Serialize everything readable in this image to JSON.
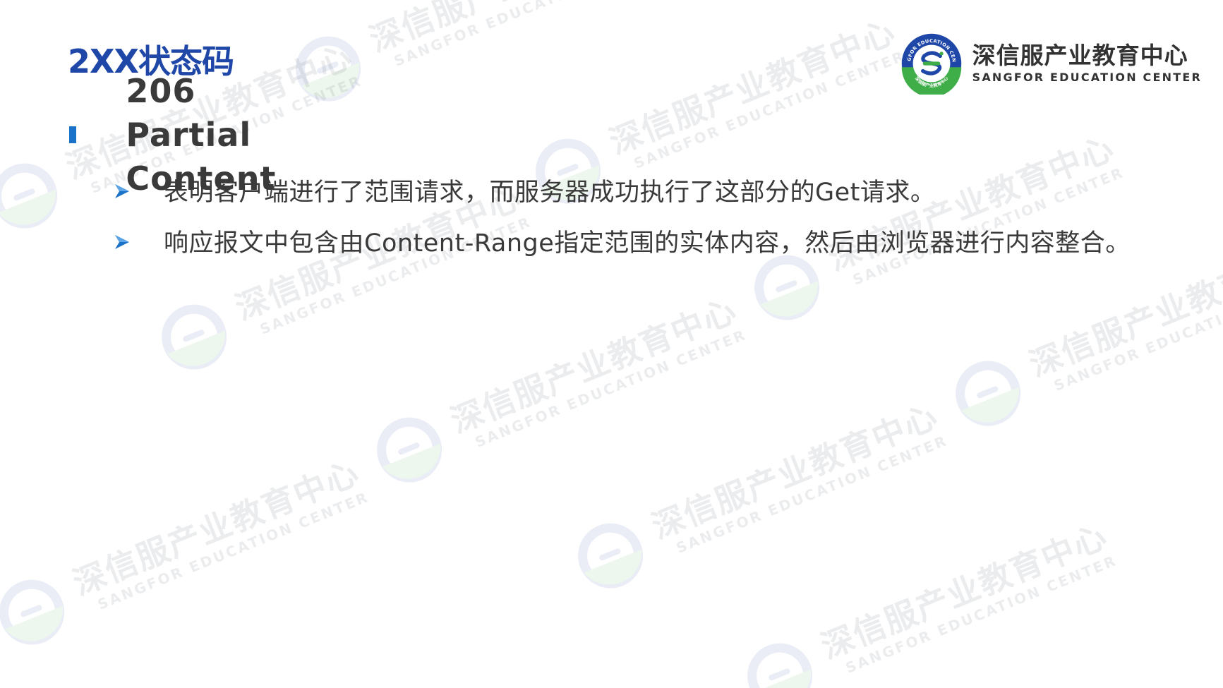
{
  "slide": {
    "title": "2XX状态码",
    "heading": "206 Partial Content",
    "bullets": [
      "表明客户端进行了范围请求，而服务器成功执行了这部分的Get请求。",
      "响应报文中包含由Content-Range指定范围的实体内容，然后由浏览器进行内容整合。"
    ]
  },
  "brand": {
    "name_cn": "深信服产业教育中心",
    "name_en": "SANGFOR EDUCATION CENTER",
    "seal_top_text": "SANGFOR EDUCATION CENTER",
    "seal_bottom_text": "深信服产业教育中心"
  },
  "watermark": {
    "name_cn": "深信服产业教育中心",
    "name_en": "SANGFOR EDUCATION CENTER"
  },
  "colors": {
    "title_blue": "#1f47a8",
    "bullet_blue": "#1a73c8",
    "seal_blue": "#1f47a8",
    "seal_green": "#3fae49",
    "text_dark": "#3a3a3a"
  },
  "icons": {
    "square_bullet": "square-bullet-icon",
    "arrow_bullet": "arrow-bullet-icon",
    "brand_seal": "sangfor-seal-logo"
  }
}
